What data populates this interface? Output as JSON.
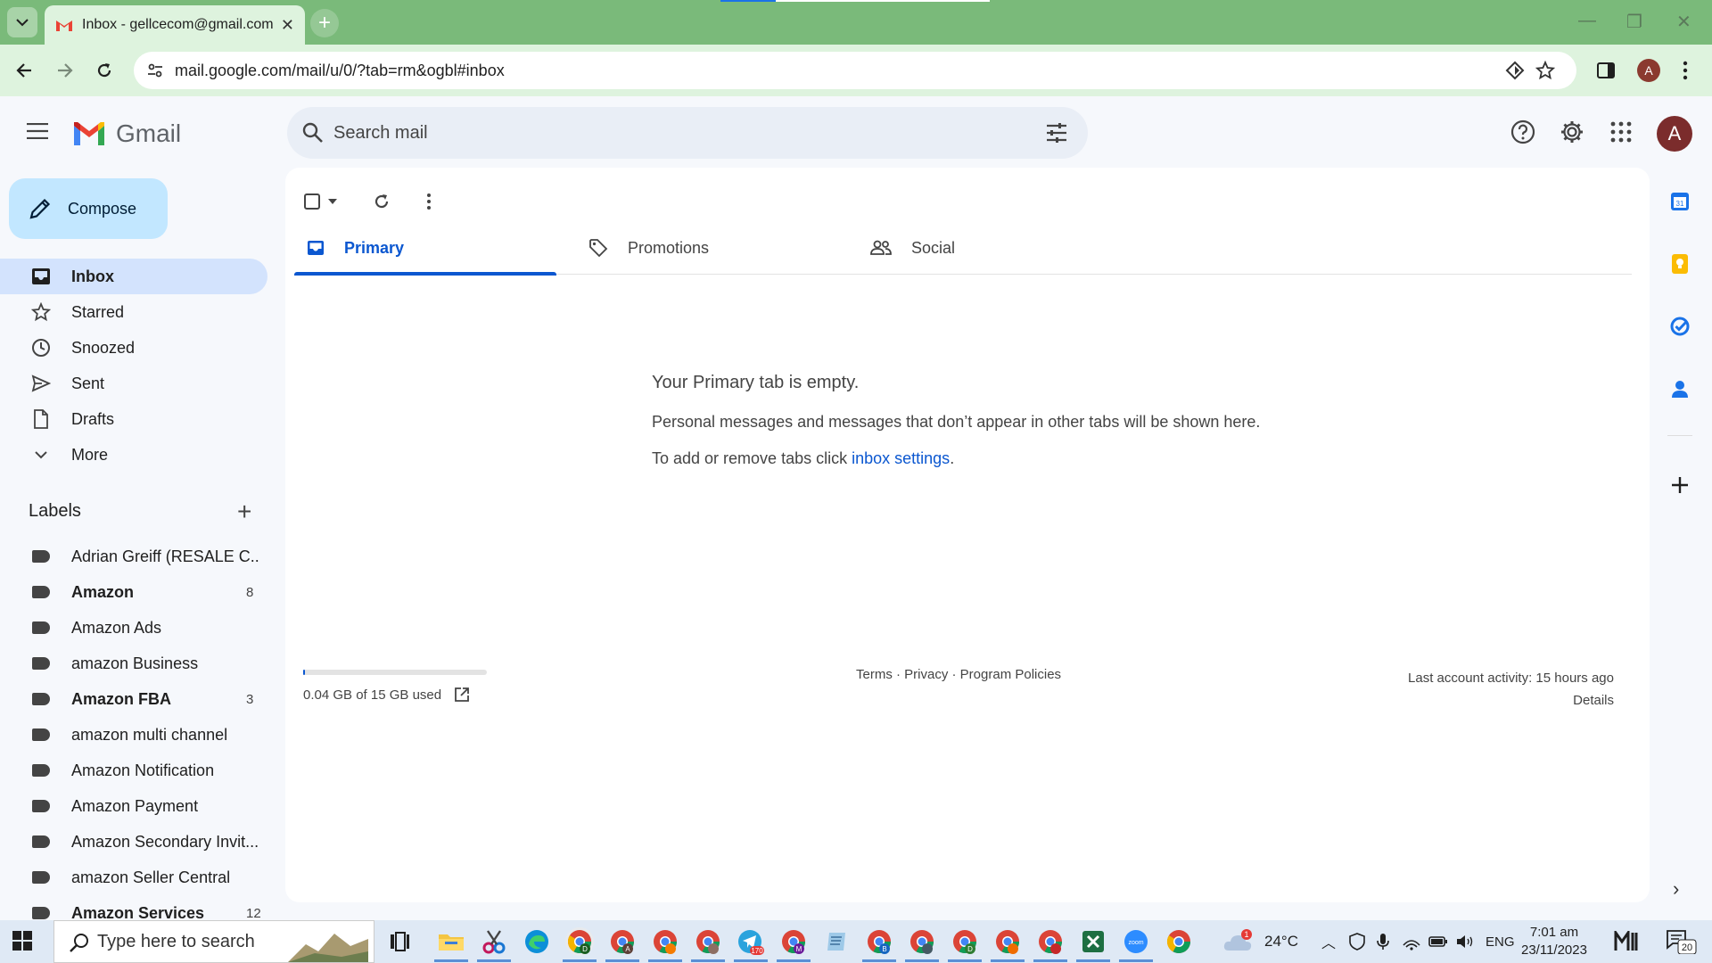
{
  "browser": {
    "tab_title": "Inbox - gellcecom@gmail.com",
    "url": "mail.google.com/mail/u/0/?tab=rm&ogbl#inbox",
    "profile_initial": "A"
  },
  "header": {
    "app_name": "Gmail",
    "search_placeholder": "Search mail",
    "avatar_initial": "A"
  },
  "compose_label": "Compose",
  "nav": [
    {
      "label": "Inbox",
      "icon": "inbox-icon",
      "active": true
    },
    {
      "label": "Starred",
      "icon": "star-icon"
    },
    {
      "label": "Snoozed",
      "icon": "clock-icon"
    },
    {
      "label": "Sent",
      "icon": "send-icon"
    },
    {
      "label": "Drafts",
      "icon": "draft-icon"
    },
    {
      "label": "More",
      "icon": "chevron-down-icon"
    }
  ],
  "labels": {
    "heading": "Labels",
    "items": [
      {
        "label": "Adrian Greiff (RESALE C...",
        "count": "",
        "bold": false
      },
      {
        "label": "Amazon",
        "count": "8",
        "bold": true
      },
      {
        "label": "Amazon Ads",
        "count": "",
        "bold": false
      },
      {
        "label": "amazon Business",
        "count": "",
        "bold": false
      },
      {
        "label": "Amazon FBA",
        "count": "3",
        "bold": true
      },
      {
        "label": "amazon multi channel",
        "count": "",
        "bold": false
      },
      {
        "label": "Amazon Notification",
        "count": "",
        "bold": false
      },
      {
        "label": "Amazon Payment",
        "count": "",
        "bold": false
      },
      {
        "label": "Amazon Secondary Invit...",
        "count": "",
        "bold": false
      },
      {
        "label": "amazon Seller Central",
        "count": "",
        "bold": false
      },
      {
        "label": "Amazon Services",
        "count": "12",
        "bold": true
      }
    ]
  },
  "tabs": [
    {
      "label": "Primary",
      "icon": "inbox-icon",
      "active": true
    },
    {
      "label": "Promotions",
      "icon": "tag-icon",
      "active": false
    },
    {
      "label": "Social",
      "icon": "people-icon",
      "active": false
    }
  ],
  "empty_state": {
    "heading": "Your Primary tab is empty.",
    "line1": "Personal messages and messages that don’t appear in other tabs will be shown here.",
    "line2_prefix": "To add or remove tabs click ",
    "line2_link": "inbox settings",
    "line2_suffix": "."
  },
  "footer": {
    "storage_text": "0.04 GB of 15 GB used",
    "storage_fraction": 0.003,
    "links": "Terms · Privacy · Program Policies",
    "activity": "Last account activity: 15 hours ago",
    "details": "Details"
  },
  "taskbar": {
    "search_placeholder": "Type here to search",
    "weather": "24°C",
    "weather_badge": "1",
    "language": "ENG",
    "time": "7:01 am",
    "date": "23/11/2023",
    "notifications": "20",
    "telegram_badge": "170"
  },
  "colors": {
    "tabstrip": "#7aba7a",
    "accent": "#0b57d0",
    "compose": "#c2e7ff",
    "active_nav": "#d3e3fd"
  }
}
